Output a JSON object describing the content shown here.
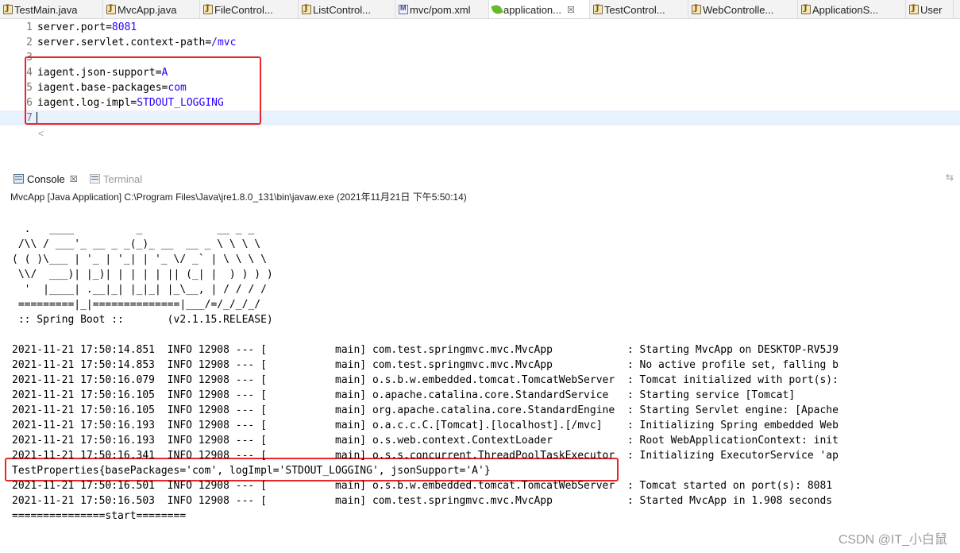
{
  "editor_tabs": [
    {
      "label": "TestMain.java",
      "icon": "java-file-icon"
    },
    {
      "label": "MvcApp.java",
      "icon": "java-file-icon"
    },
    {
      "label": "FileControl...",
      "icon": "java-file-icon"
    },
    {
      "label": "ListControl...",
      "icon": "java-file-icon"
    },
    {
      "label": "mvc/pom.xml",
      "icon": "maven-pom-icon"
    },
    {
      "label": "application...",
      "icon": "spring-leaf-icon",
      "active": true,
      "close": "☒"
    },
    {
      "label": "TestControl...",
      "icon": "java-file-icon"
    },
    {
      "label": "WebControlle...",
      "icon": "java-file-icon"
    },
    {
      "label": "ApplicationS...",
      "icon": "java-file-icon"
    },
    {
      "label": "User",
      "icon": "java-file-icon"
    }
  ],
  "editor": {
    "lines": [
      {
        "num": "1",
        "key": "server.port=",
        "value": "8081"
      },
      {
        "num": "2",
        "key": "server.servlet.context-path=",
        "value": "/mvc"
      },
      {
        "num": "3",
        "key": "",
        "value": ""
      },
      {
        "num": "4",
        "key": "iagent.json-support=",
        "value": "A"
      },
      {
        "num": "5",
        "key": "iagent.base-packages=",
        "value": "com"
      },
      {
        "num": "6",
        "key": "iagent.log-impl=",
        "value": "STDOUT_LOGGING"
      },
      {
        "num": "7",
        "key": "",
        "value": ""
      }
    ],
    "scroll_left": "<"
  },
  "console_view": {
    "console_tab": "Console",
    "console_close": "☒",
    "terminal_tab": "Terminal",
    "launch_info": "MvcApp [Java Application] C:\\Program Files\\Java\\jre1.8.0_131\\bin\\javaw.exe (2021年11月21日 下午5:50:14)",
    "lines": [
      "  .   ____          _            __ _ _",
      " /\\\\ / ___'_ __ _ _(_)_ __  __ _ \\ \\ \\ \\",
      "( ( )\\___ | '_ | '_| | '_ \\/ _` | \\ \\ \\ \\",
      " \\\\/  ___)| |_)| | | | | || (_| |  ) ) ) )",
      "  '  |____| .__|_| |_|_| |_\\__, | / / / /",
      " =========|_|==============|___/=/_/_/_/",
      " :: Spring Boot ::       (v2.1.15.RELEASE)",
      "",
      "2021-11-21 17:50:14.851  INFO 12908 --- [           main] com.test.springmvc.mvc.MvcApp            : Starting MvcApp on DESKTOP-RV5J9",
      "2021-11-21 17:50:14.853  INFO 12908 --- [           main] com.test.springmvc.mvc.MvcApp            : No active profile set, falling b",
      "2021-11-21 17:50:16.079  INFO 12908 --- [           main] o.s.b.w.embedded.tomcat.TomcatWebServer  : Tomcat initialized with port(s):",
      "2021-11-21 17:50:16.105  INFO 12908 --- [           main] o.apache.catalina.core.StandardService   : Starting service [Tomcat]",
      "2021-11-21 17:50:16.105  INFO 12908 --- [           main] org.apache.catalina.core.StandardEngine  : Starting Servlet engine: [Apache",
      "2021-11-21 17:50:16.193  INFO 12908 --- [           main] o.a.c.c.C.[Tomcat].[localhost].[/mvc]    : Initializing Spring embedded Web",
      "2021-11-21 17:50:16.193  INFO 12908 --- [           main] o.s.web.context.ContextLoader            : Root WebApplicationContext: init",
      "2021-11-21 17:50:16.341  INFO 12908 --- [           main] o.s.s.concurrent.ThreadPoolTaskExecutor  : Initializing ExecutorService 'ap",
      "TestProperties{basePackages='com', logImpl='STDOUT_LOGGING', jsonSupport='A'}",
      "2021-11-21 17:50:16.501  INFO 12908 --- [           main] o.s.b.w.embedded.tomcat.TomcatWebServer  : Tomcat started on port(s): 8081",
      "2021-11-21 17:50:16.503  INFO 12908 --- [           main] com.test.springmvc.mvc.MvcApp            : Started MvcApp in 1.908 seconds",
      "===============start========"
    ]
  },
  "watermark": "CSDN @IT_小白鼠",
  "colors": {
    "annotation_red": "#e8262a",
    "property_value": "#2a00ff",
    "current_line": "#e8f2fe"
  }
}
